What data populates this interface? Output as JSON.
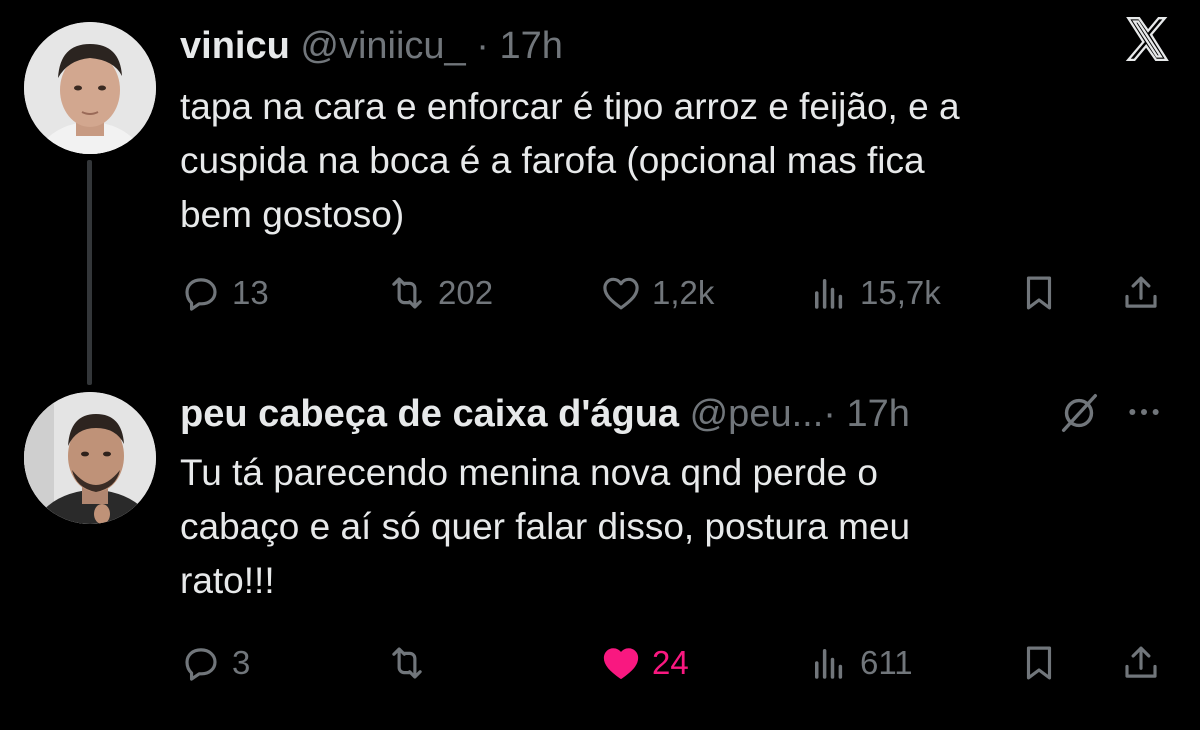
{
  "tweets": [
    {
      "name": "vinicu",
      "handle": "@viniicu_",
      "separator": "·",
      "time": "17h",
      "text": "tapa na cara e enforcar é tipo arroz e feijão, e a\ncuspida na boca é a farofa (opcional mas fica\nbem gostoso)",
      "replies": "13",
      "reposts": "202",
      "likes": "1,2k",
      "views": "15,7k"
    },
    {
      "name": "peu cabeça de caixa d'água",
      "handle": "@peu...",
      "separator": "·",
      "time": "17h",
      "text": "Tu tá parecendo menina nova qnd perde o\ncabaço e aí só quer falar disso, postura meu\nrato!!!",
      "replies": "3",
      "reposts": "",
      "likes": "24",
      "views": "611"
    }
  ],
  "colors": {
    "background": "#000000",
    "text": "#e7e9ea",
    "muted": "#71767b",
    "like_active": "#f91880"
  },
  "icons": [
    "x-logo",
    "reply-icon",
    "repost-icon",
    "like-icon",
    "views-icon",
    "bookmark-icon",
    "share-icon",
    "grok-icon",
    "more-icon"
  ]
}
